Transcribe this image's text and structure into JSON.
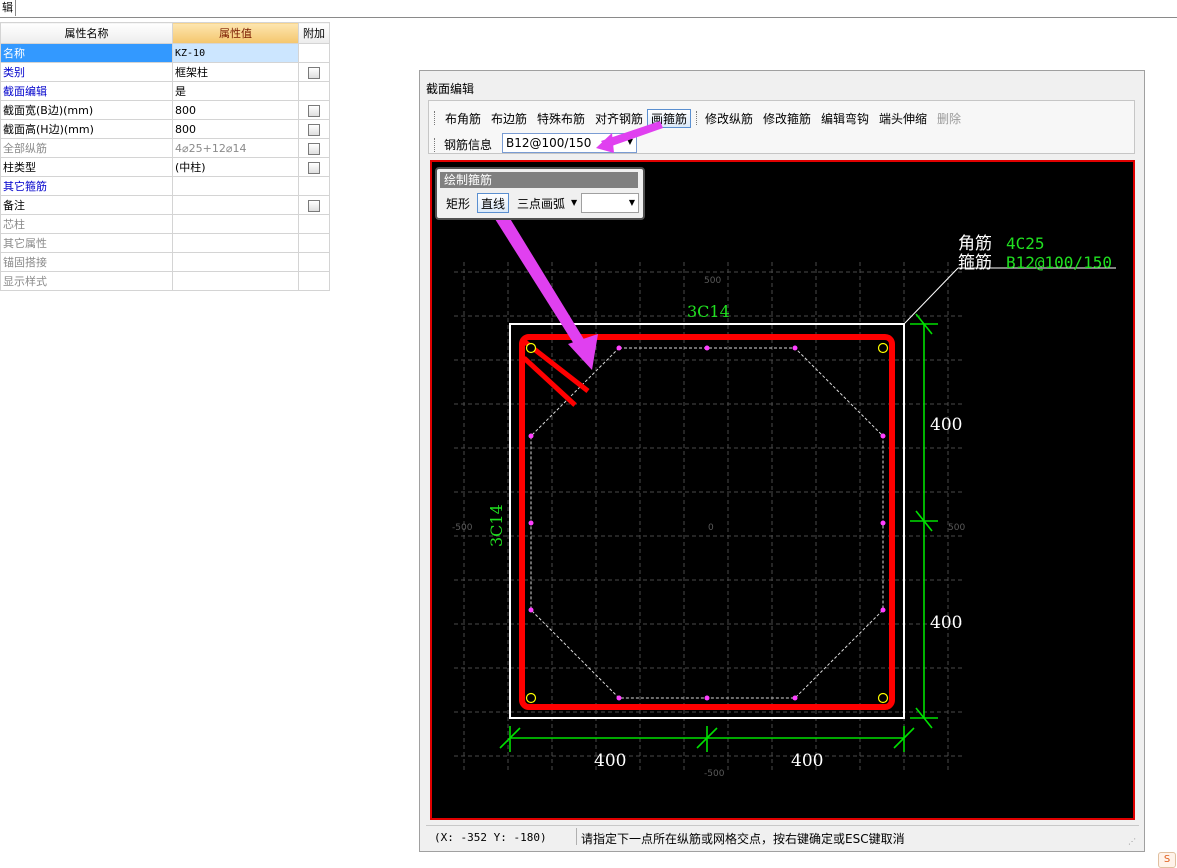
{
  "top_tab": {
    "label": "辑"
  },
  "property_table": {
    "headers": [
      "属性名称",
      "属性值",
      "附加"
    ],
    "rows": [
      {
        "name": "名称",
        "value": "KZ-10",
        "check": false
      },
      {
        "name": "类别",
        "value": "框架柱",
        "check": true
      },
      {
        "name": "截面编辑",
        "value": "是",
        "check": false
      },
      {
        "name": "截面宽(B边)(mm)",
        "value": "800",
        "check": true
      },
      {
        "name": "截面高(H边)(mm)",
        "value": "800",
        "check": true
      },
      {
        "name": "全部纵筋",
        "value": "4⌀25+12⌀14",
        "check": true
      },
      {
        "name": "柱类型",
        "value": "(中柱)",
        "check": true
      },
      {
        "name": "其它箍筋",
        "value": "",
        "check": false
      },
      {
        "name": "备注",
        "value": "",
        "check": true
      },
      {
        "name": "芯柱",
        "value": "",
        "check": false
      },
      {
        "name": "其它属性",
        "value": "",
        "check": false
      },
      {
        "name": "锚固搭接",
        "value": "",
        "check": false
      },
      {
        "name": "显示样式",
        "value": "",
        "check": false
      }
    ]
  },
  "dialog": {
    "title": "截面编辑",
    "toolbar": [
      "布角筋",
      "布边筋",
      "特殊布筋",
      "对齐钢筋",
      "画箍筋",
      "修改纵筋",
      "修改箍筋",
      "编辑弯钩",
      "端头伸缩",
      "删除"
    ],
    "rebar_info_label": "钢筋信息",
    "rebar_info_value": "B12@100/150",
    "draw_panel": {
      "title": "绘制箍筋",
      "buttons": [
        "矩形",
        "直线",
        "三点画弧"
      ],
      "combo_value": ""
    },
    "canvas": {
      "corner_label": "角筋",
      "corner_value": "4C25",
      "stirrup_label": "箍筋",
      "stirrup_value": "B12@100/150",
      "top_bars": "3C14",
      "left_bars": "3C14",
      "dim_right_upper": "400",
      "dim_right_lower": "400",
      "dim_bottom_left": "400",
      "dim_bottom_right": "400",
      "grid_top": "500",
      "grid_left": "-500",
      "grid_right": "500",
      "grid_bottom": "-500",
      "grid_center": "0"
    },
    "status_coord": "(X: -352 Y: -180)",
    "status_message": "请指定下一点所在纵筋或网格交点，按右键确定或ESC键取消"
  },
  "colors": {
    "stirrup": "#ff0000",
    "dimension": "#00e000",
    "arrow": "#e040f0",
    "canvas_bg": "#000000"
  }
}
